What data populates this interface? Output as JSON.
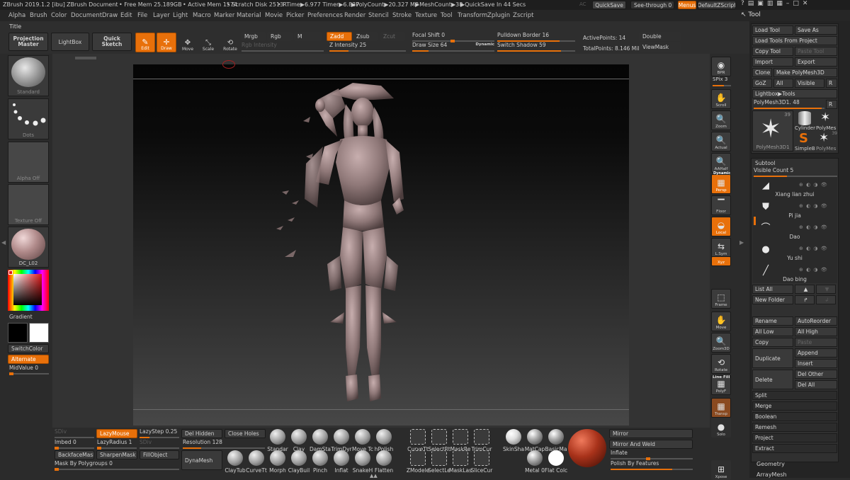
{
  "titlebar": {
    "app": "ZBrush 2019.1.2 [ibu]",
    "doc": "ZBrush Document",
    "free_mem": "• Free Mem 25.189GB",
    "active_mem": "• Active Mem 1574",
    "scratch": "• Scratch Disk 2513",
    "rtime": "• RTime▶6.977 Timer▶6.837",
    "polycount": "▶PolyCount▶20.327 MP",
    "meshcount": "▶MeshCount▶38",
    "quicksave_in": "▶QuickSave In 44 Secs",
    "ac": "AC",
    "quicksave": "QuickSave",
    "see_through": "See-through  0",
    "menus": "Menus",
    "default_script": "DefaultZScript"
  },
  "menubar": [
    "Alpha",
    "Brush",
    "Color",
    "Document",
    "Draw",
    "Edit",
    "File",
    "Layer",
    "Light",
    "Macro",
    "Marker",
    "Material",
    "Movie",
    "Picker",
    "Preferences",
    "Render",
    "Stencil",
    "Stroke",
    "Texture",
    "Tool",
    "Transform",
    "Zplugin",
    "Zscript"
  ],
  "toolbar": {
    "title": "Title",
    "projection_master": "Projection Master",
    "lightbox": "LightBox",
    "quick_sketch": "Quick Sketch",
    "edit": "Edit",
    "draw": "Draw",
    "move": "Move",
    "scale": "Scale",
    "rotate": "Rotate",
    "mrgb": "Mrgb",
    "rgb": "Rgb",
    "m": "M",
    "rgb_intensity": "Rgb Intensity",
    "zadd": "Zadd",
    "zsub": "Zsub",
    "zcut": "Zcut",
    "z_intensity": "Z Intensity 25",
    "focal_shift": "Focal Shift 0",
    "draw_size": "Draw Size 64",
    "dynamic": "Dynamic",
    "pulldown_border": "Pulldown Border 16",
    "switch_shadow": "Switch Shadow 59",
    "active_points": "ActivePoints: 14",
    "total_points": "TotalPoints: 8.146 Mil",
    "double": "Double",
    "viewmask": "ViewMask"
  },
  "left_shelf": {
    "standard": "Standard",
    "dots": "Dots",
    "alpha_off": "Alpha Off",
    "texture_off": "Texture Off",
    "material": "DC_L02",
    "gradient": "Gradient",
    "switch_color": "SwitchColor",
    "alternate": "Alternate",
    "mid_value": "MidValue 0"
  },
  "right_shelf": [
    "BPR",
    "SPix 3",
    "Scroll",
    "Zoom",
    "Actual",
    "AAHalf",
    "Persp",
    "Floor",
    "Local",
    "L.Sym",
    "Xyz",
    "Frame",
    "Move",
    "Zoom3D",
    "Rotate",
    "PolyF",
    "Transp",
    "Solo",
    "Xpose"
  ],
  "right_shelf_extra": {
    "dynamic_label": "Dynamic",
    "line_fill": "Line Fill"
  },
  "tool_panel": {
    "header": "Tool",
    "load_tool": "Load Tool",
    "save_as": "Save As",
    "load_from_project": "Load Tools From Project",
    "copy_tool": "Copy Tool",
    "paste_tool": "Paste Tool",
    "import": "Import",
    "export": "Export",
    "clone": "Clone",
    "make_polymesh": "Make PolyMesh3D",
    "goz": "GoZ",
    "all": "All",
    "visible": "Visible",
    "r": "R",
    "lightbox_tools": "Lightbox▶Tools",
    "polymesh_name": "PolyMesh3D1. 48",
    "thumbs": {
      "count1": "39",
      "count2": "39",
      "cylinder": "Cylinder",
      "polymesh_a": "PolyMes",
      "polymesh_main": "PolyMesh3D1",
      "simpleb": "SimpleB",
      "polymesh_b": "PolyMes"
    },
    "subtool_header": "Subtool",
    "visible_count": "Visible Count 5",
    "subtools": [
      "Xiang lian zhui",
      "Pi jia",
      "Dao",
      "Yu shi",
      "Dao bing"
    ],
    "list_all": "List All",
    "new_folder": "New Folder",
    "rename": "Rename",
    "autoreorder": "AutoReorder",
    "all_low": "All Low",
    "all_high": "All High",
    "copy": "Copy",
    "paste": "Paste",
    "duplicate": "Duplicate",
    "append": "Append",
    "insert": "Insert",
    "delete": "Delete",
    "del_other": "Del Other",
    "del_all": "Del All",
    "sections": [
      "Split",
      "Merge",
      "Boolean",
      "Remesh",
      "Project",
      "Extract"
    ],
    "geometry": "Geometry",
    "arraymesh": "ArrayMesh"
  },
  "bottom": {
    "sdiv": "SDiv",
    "lazymouse": "LazyMouse",
    "lazystep": "LazyStep 0.25",
    "del_hidden": "Del Hidden",
    "close_holes": "Close Holes",
    "imbed": "Imbed 0",
    "lazyradius": "LazyRadius 1",
    "sdiv2": "SDiv",
    "resolution": "Resolution 128",
    "backface": "BackfaceMask",
    "sharpen": "SharpenMask",
    "fillobject": "FillObject",
    "dynamesh": "DynaMesh",
    "mask_by_polygroups": "Mask By Polygroups 0",
    "brushes_row1": [
      "Standar",
      "Clay",
      "DamSta",
      "TrimDyr",
      "Move Tc",
      "hPolish"
    ],
    "brushes_row2": [
      "ClayTub",
      "CurveTt",
      "Morph",
      "ClayBuil",
      "Pinch",
      "Inflat",
      "SnakeH",
      "Flatten"
    ],
    "curve_row1": [
      "CurveTt",
      "SelectRt",
      "MaskRe",
      "TrimCur"
    ],
    "curve_row2": [
      "ZModele",
      "SelectLe",
      "MaskLas",
      "SliceCur"
    ],
    "materials_row1": [
      "SkinSha",
      "MatCap",
      "BasicMa"
    ],
    "materials_row2": [
      "Metal 0",
      "Flat Colc"
    ],
    "mirror": "Mirror",
    "mirror_weld": "Mirror And Weld",
    "inflate": "Inflate",
    "polish_features": "Polish By Features"
  },
  "colors": {
    "accent": "#e8700a",
    "panel": "#2b2b2b",
    "canvas": "#0b0b0b",
    "material_red": "#a8321a"
  }
}
